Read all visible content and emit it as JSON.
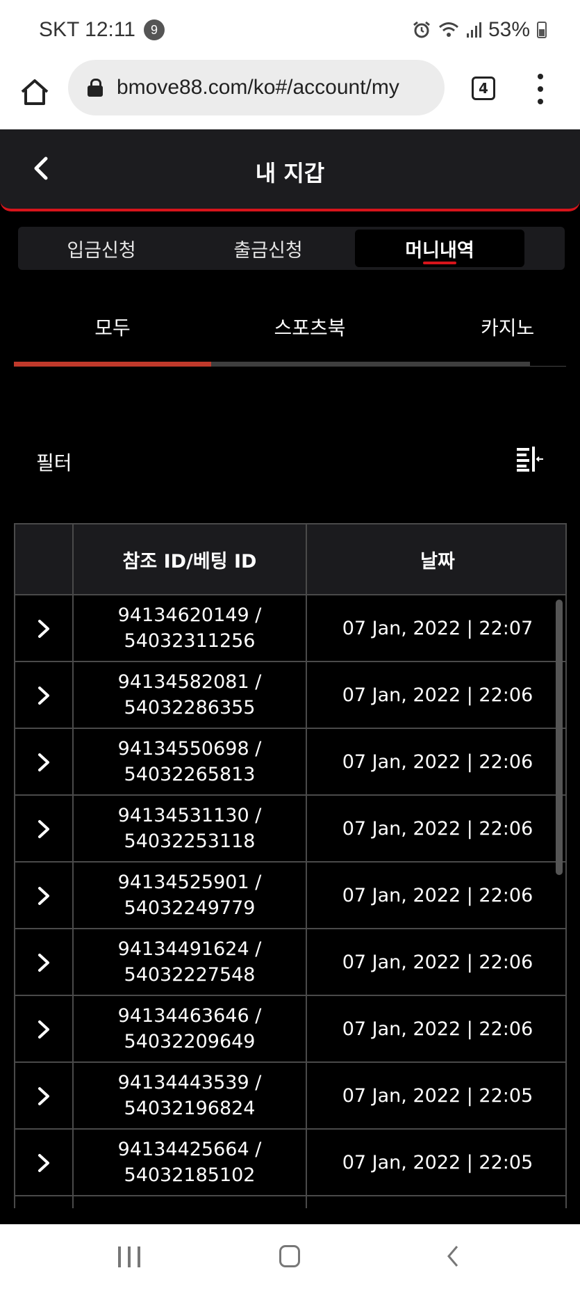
{
  "status_bar": {
    "carrier_time": "SKT 12:11",
    "notification_count": "9",
    "battery": "53%",
    "icons": [
      "alarm-icon",
      "wifi-icon",
      "signal-icon",
      "battery-icon"
    ]
  },
  "browser": {
    "url": "bmove88.com/ko#/account/my",
    "tab_count": "4"
  },
  "header": {
    "title": "내 지갑"
  },
  "main_tabs": [
    {
      "label": "입금신청",
      "active": false
    },
    {
      "label": "출금신청",
      "active": false
    },
    {
      "label": "머니내역",
      "active": true
    }
  ],
  "sub_tabs": [
    {
      "label": "모두",
      "active": true
    },
    {
      "label": "스포츠북",
      "active": false
    },
    {
      "label": "카지노",
      "active": false
    }
  ],
  "filter": {
    "label": "필터"
  },
  "table": {
    "headers": [
      "",
      "참조 ID/베팅 ID",
      "날짜"
    ],
    "rows": [
      {
        "ref_id": "94134620149 /",
        "bet_id": "54032311256",
        "date": "07 Jan, 2022 | 22:07"
      },
      {
        "ref_id": "94134582081 /",
        "bet_id": "54032286355",
        "date": "07 Jan, 2022 | 22:06"
      },
      {
        "ref_id": "94134550698 /",
        "bet_id": "54032265813",
        "date": "07 Jan, 2022 | 22:06"
      },
      {
        "ref_id": "94134531130 /",
        "bet_id": "54032253118",
        "date": "07 Jan, 2022 | 22:06"
      },
      {
        "ref_id": "94134525901 /",
        "bet_id": "54032249779",
        "date": "07 Jan, 2022 | 22:06"
      },
      {
        "ref_id": "94134491624 /",
        "bet_id": "54032227548",
        "date": "07 Jan, 2022 | 22:06"
      },
      {
        "ref_id": "94134463646 /",
        "bet_id": "54032209649",
        "date": "07 Jan, 2022 | 22:06"
      },
      {
        "ref_id": "94134443539 /",
        "bet_id": "54032196824",
        "date": "07 Jan, 2022 | 22:05"
      },
      {
        "ref_id": "94134425664 /",
        "bet_id": "54032185102",
        "date": "07 Jan, 2022 | 22:05"
      }
    ]
  },
  "colors": {
    "accent": "#d6141b",
    "background": "#000000",
    "panel": "#1b1b1e"
  }
}
